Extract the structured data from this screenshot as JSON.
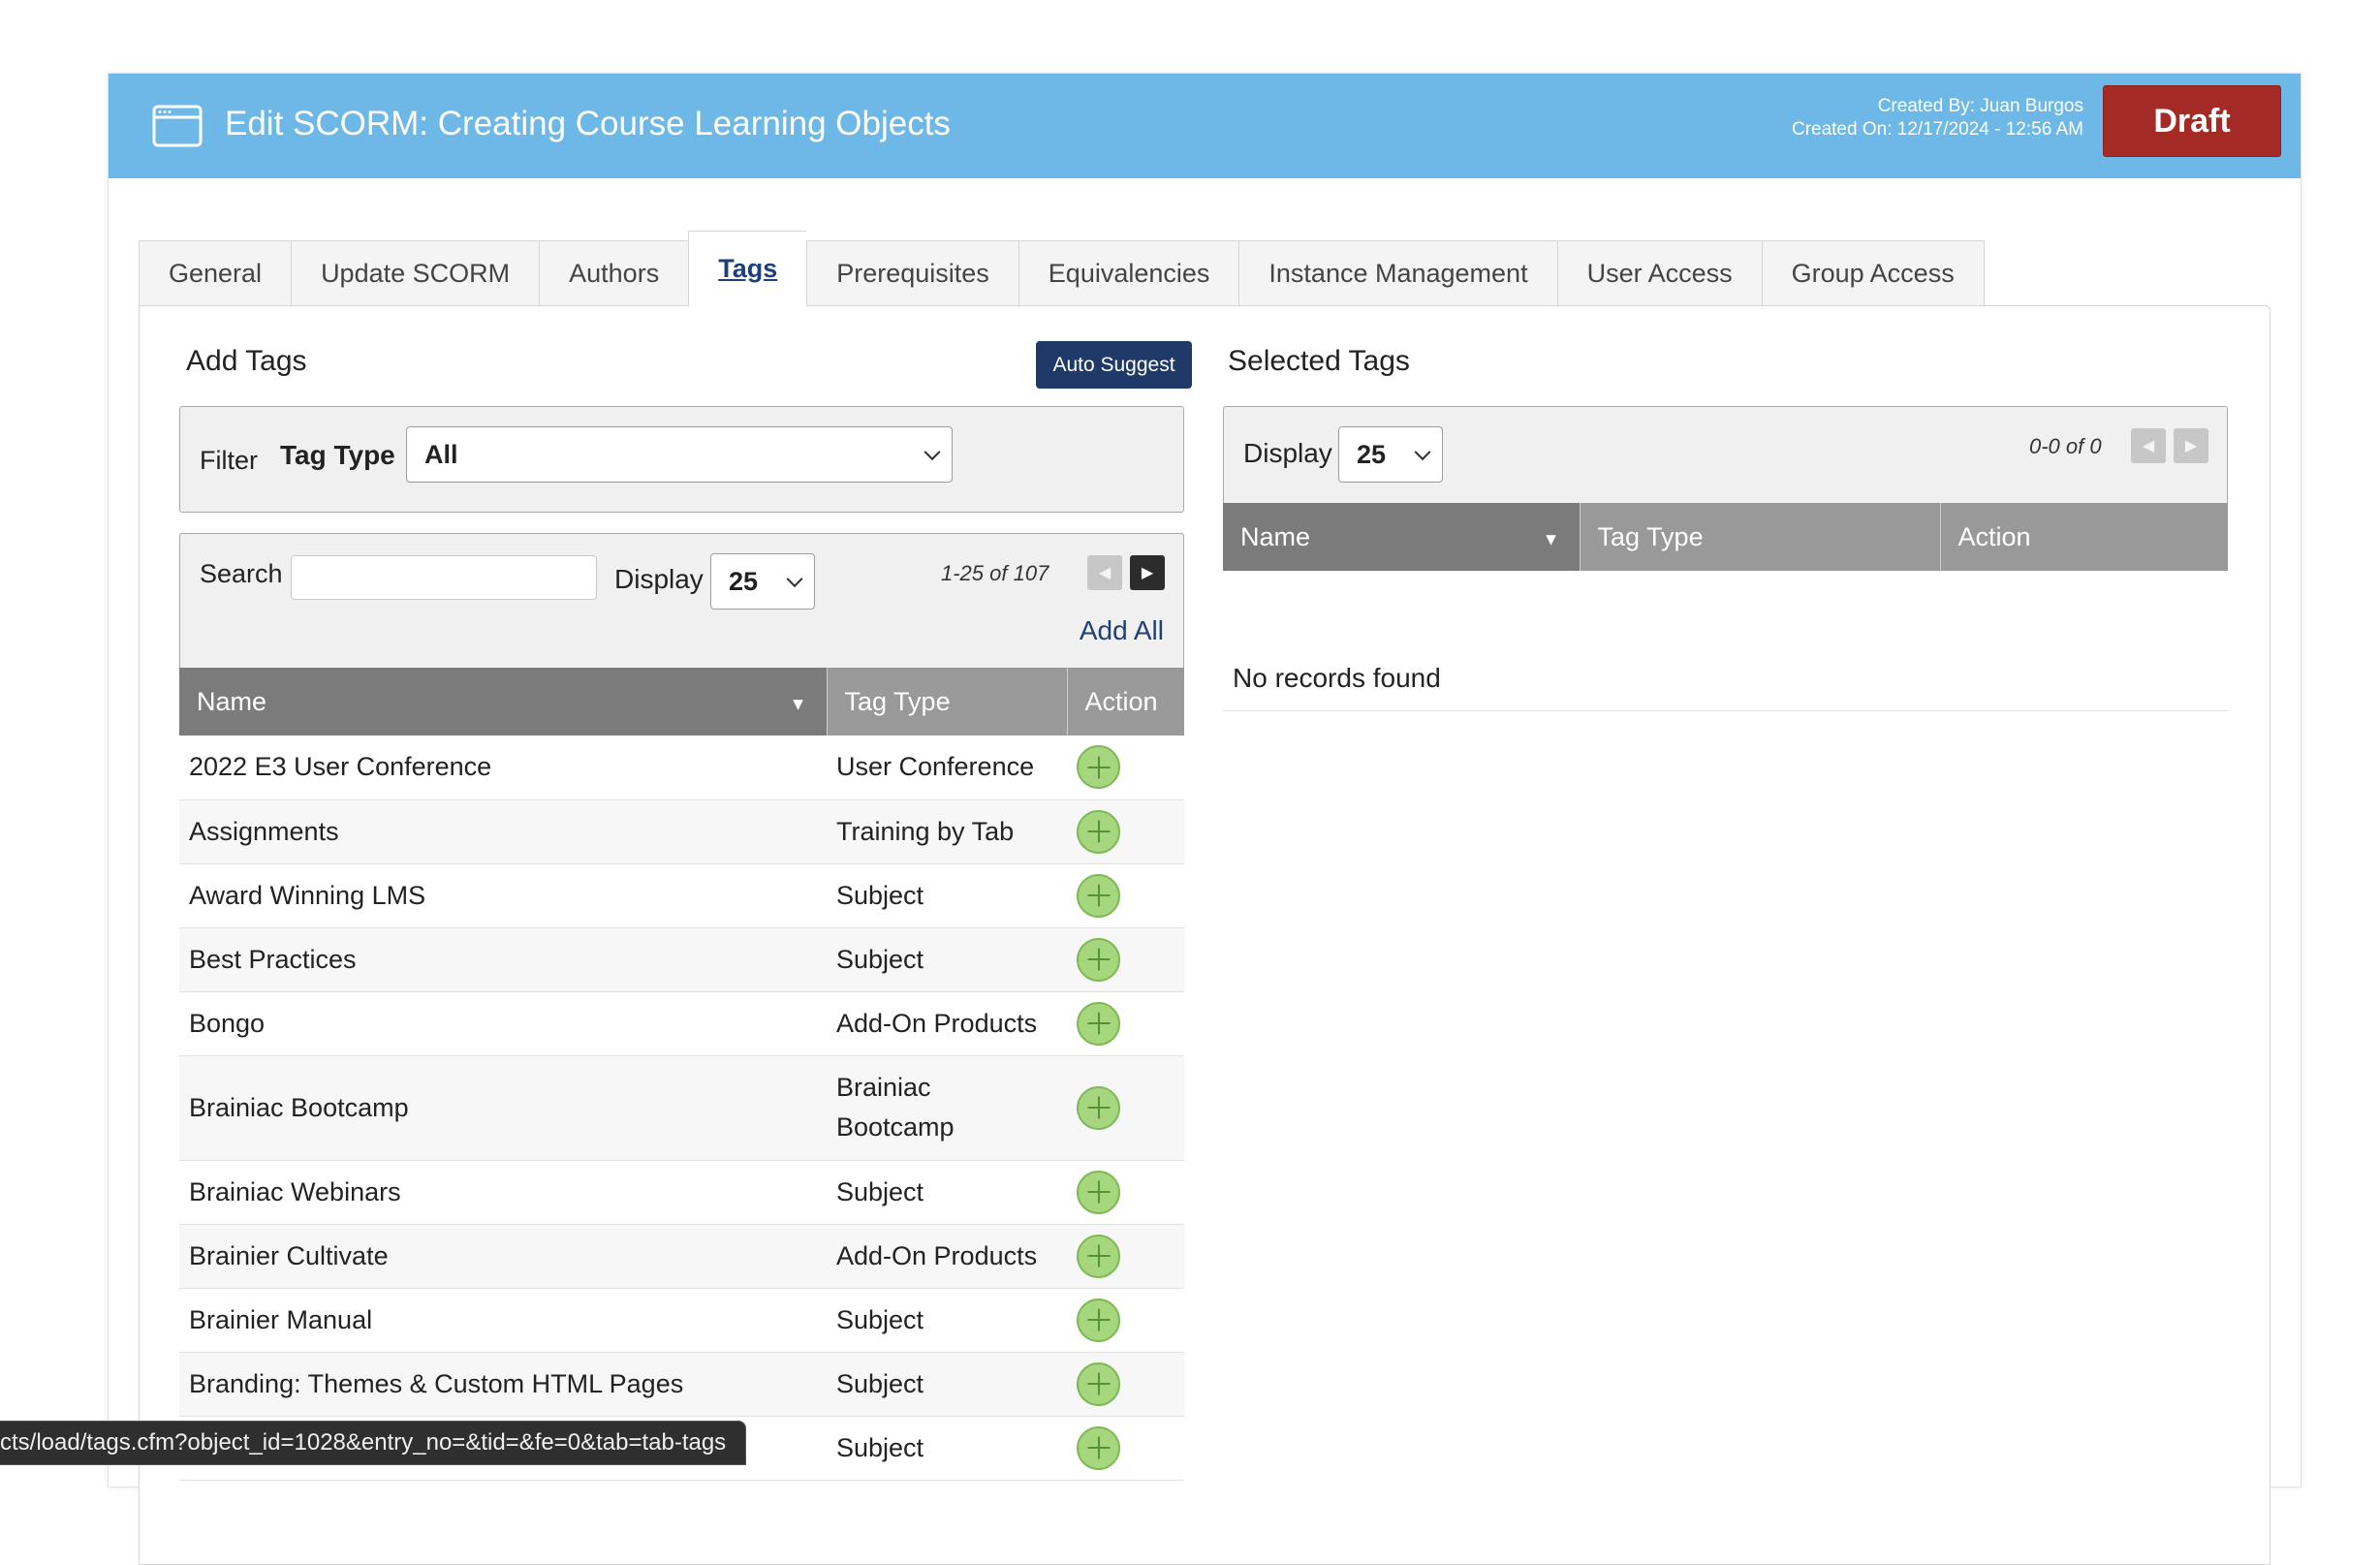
{
  "header": {
    "title": "Edit SCORM: Creating Course Learning Objects",
    "created_by": "Created By: Juan Burgos",
    "created_on": "Created On: 12/17/2024 - 12:56 AM",
    "status_button": "Draft",
    "colors": {
      "header_bg": "#6db8e6",
      "draft_bg": "#a42a25"
    }
  },
  "tabs": [
    {
      "label": "General",
      "active": false
    },
    {
      "label": "Update SCORM",
      "active": false
    },
    {
      "label": "Authors",
      "active": false
    },
    {
      "label": "Tags",
      "active": true
    },
    {
      "label": "Prerequisites",
      "active": false
    },
    {
      "label": "Equivalencies",
      "active": false
    },
    {
      "label": "Instance Management",
      "active": false
    },
    {
      "label": "User Access",
      "active": false
    },
    {
      "label": "Group Access",
      "active": false
    }
  ],
  "add_tags": {
    "title": "Add Tags",
    "auto_suggest": "Auto Suggest",
    "filter_label": "Filter",
    "tag_type_label": "Tag Type",
    "tag_type_value": "All",
    "search_label": "Search",
    "search_value": "",
    "display_label": "Display",
    "display_value": "25",
    "count": "1-25 of 107",
    "add_all": "Add All",
    "columns": {
      "name": "Name",
      "tag_type": "Tag Type",
      "action": "Action"
    },
    "rows": [
      {
        "name": "2022 E3 User Conference",
        "tag_type": "User Conference"
      },
      {
        "name": "Assignments",
        "tag_type": "Training by Tab"
      },
      {
        "name": "Award Winning LMS",
        "tag_type": "Subject"
      },
      {
        "name": "Best Practices",
        "tag_type": "Subject"
      },
      {
        "name": "Bongo",
        "tag_type": "Add-On Products"
      },
      {
        "name": "Brainiac Bootcamp",
        "tag_type": "Brainiac Bootcamp"
      },
      {
        "name": "Brainiac Webinars",
        "tag_type": "Subject"
      },
      {
        "name": "Brainier Cultivate",
        "tag_type": "Add-On Products"
      },
      {
        "name": "Brainier Manual",
        "tag_type": "Subject"
      },
      {
        "name": "Branding: Themes & Custom HTML Pages",
        "tag_type": "Subject"
      },
      {
        "name": "",
        "tag_type": "Subject"
      }
    ]
  },
  "selected_tags": {
    "title": "Selected Tags",
    "display_label": "Display",
    "display_value": "25",
    "count": "0-0 of 0",
    "columns": {
      "name": "Name",
      "tag_type": "Tag Type",
      "action": "Action"
    },
    "empty_text": "No records found"
  },
  "status_url": "cts/load/tags.cfm?object_id=1028&entry_no=&tid=&fe=0&tab=tab-tags"
}
